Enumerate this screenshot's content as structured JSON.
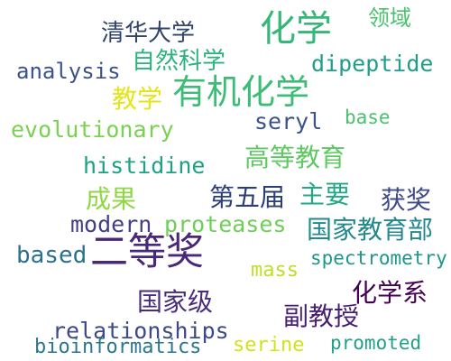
{
  "words": [
    {
      "text": "化学",
      "color": "#35b779"
    },
    {
      "text": "清华大学",
      "color": "#31446b"
    },
    {
      "text": "领域",
      "color": "#4ac16d"
    },
    {
      "text": "自然科学",
      "color": "#2db27d"
    },
    {
      "text": "analysis",
      "color": "#3b528b"
    },
    {
      "text": "dipeptide",
      "color": "#1f9e89"
    },
    {
      "text": "有机化学",
      "color": "#3cbc75"
    },
    {
      "text": "教学",
      "color": "#e5e419"
    },
    {
      "text": "seryl",
      "color": "#3b528b"
    },
    {
      "text": "base",
      "color": "#4ac16d"
    },
    {
      "text": "evolutionary",
      "color": "#7ad151"
    },
    {
      "text": "高等教育",
      "color": "#5ec962"
    },
    {
      "text": "histidine",
      "color": "#1fa187"
    },
    {
      "text": "成果",
      "color": "#8fd744"
    },
    {
      "text": "第五届",
      "color": "#2c3e78"
    },
    {
      "text": "主要",
      "color": "#22a884"
    },
    {
      "text": "获奖",
      "color": "#3e4a89"
    },
    {
      "text": "modern",
      "color": "#433e85"
    },
    {
      "text": "proteases",
      "color": "#6ece58"
    },
    {
      "text": "国家教育部",
      "color": "#23898e"
    },
    {
      "text": "based",
      "color": "#2d708e"
    },
    {
      "text": "二等奖",
      "color": "#482878"
    },
    {
      "text": "mass",
      "color": "#bddf26"
    },
    {
      "text": "spectrometry",
      "color": "#1f968b"
    },
    {
      "text": "国家级",
      "color": "#472d7b"
    },
    {
      "text": "化学系",
      "color": "#440154"
    },
    {
      "text": "relationships",
      "color": "#3e4989"
    },
    {
      "text": "副教授",
      "color": "#481f70"
    },
    {
      "text": "bioinformatics",
      "color": "#2a788e"
    },
    {
      "text": "serine",
      "color": "#d2e21b"
    },
    {
      "text": "promoted",
      "color": "#1fa187"
    }
  ]
}
